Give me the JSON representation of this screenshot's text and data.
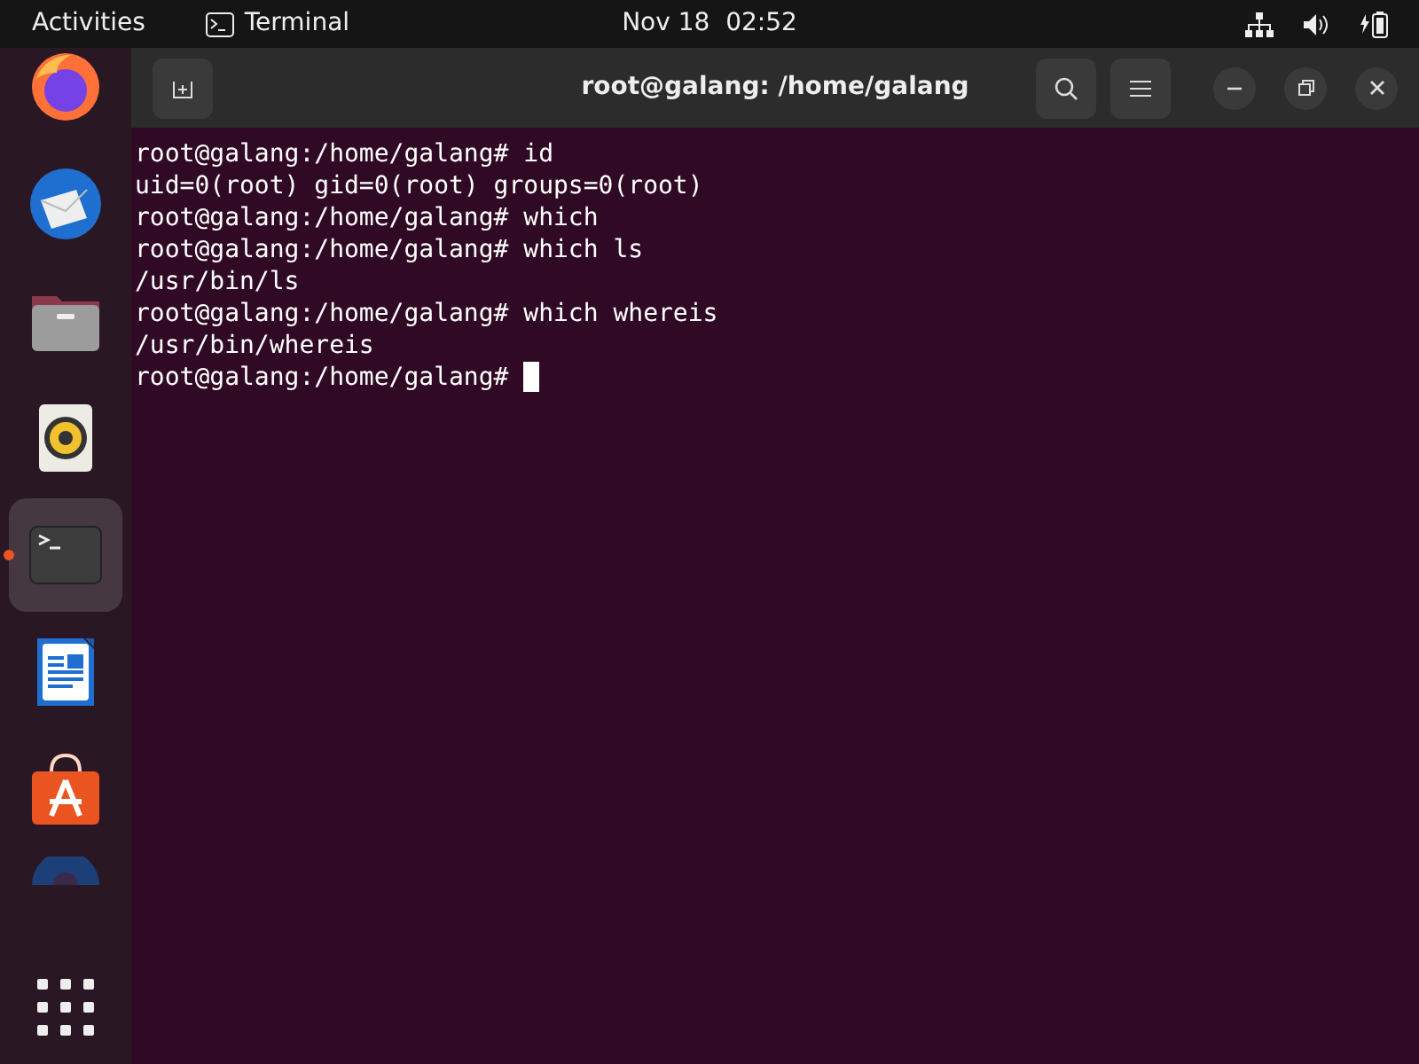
{
  "top_bar": {
    "activities": "Activities",
    "app_name": "Terminal",
    "clock": "Nov 18  02:52"
  },
  "dock": {
    "items": [
      {
        "kind": "firefox",
        "selected": false,
        "running": false
      },
      {
        "kind": "thunderbird",
        "selected": false,
        "running": false
      },
      {
        "kind": "files",
        "selected": false,
        "running": false
      },
      {
        "kind": "rhythmbox",
        "selected": false,
        "running": false
      },
      {
        "kind": "terminal",
        "selected": true,
        "running": true
      },
      {
        "kind": "writer",
        "selected": false,
        "running": false
      },
      {
        "kind": "software",
        "selected": false,
        "running": false
      },
      {
        "kind": "partial",
        "selected": false,
        "running": false
      }
    ]
  },
  "window": {
    "title": "root@galang: /home/galang",
    "lines": [
      "root@galang:/home/galang# id",
      "uid=0(root) gid=0(root) groups=0(root)",
      "root@galang:/home/galang# which",
      "root@galang:/home/galang# which ls",
      "/usr/bin/ls",
      "root@galang:/home/galang# which whereis",
      "/usr/bin/whereis",
      "root@galang:/home/galang# "
    ],
    "cursor": true
  }
}
